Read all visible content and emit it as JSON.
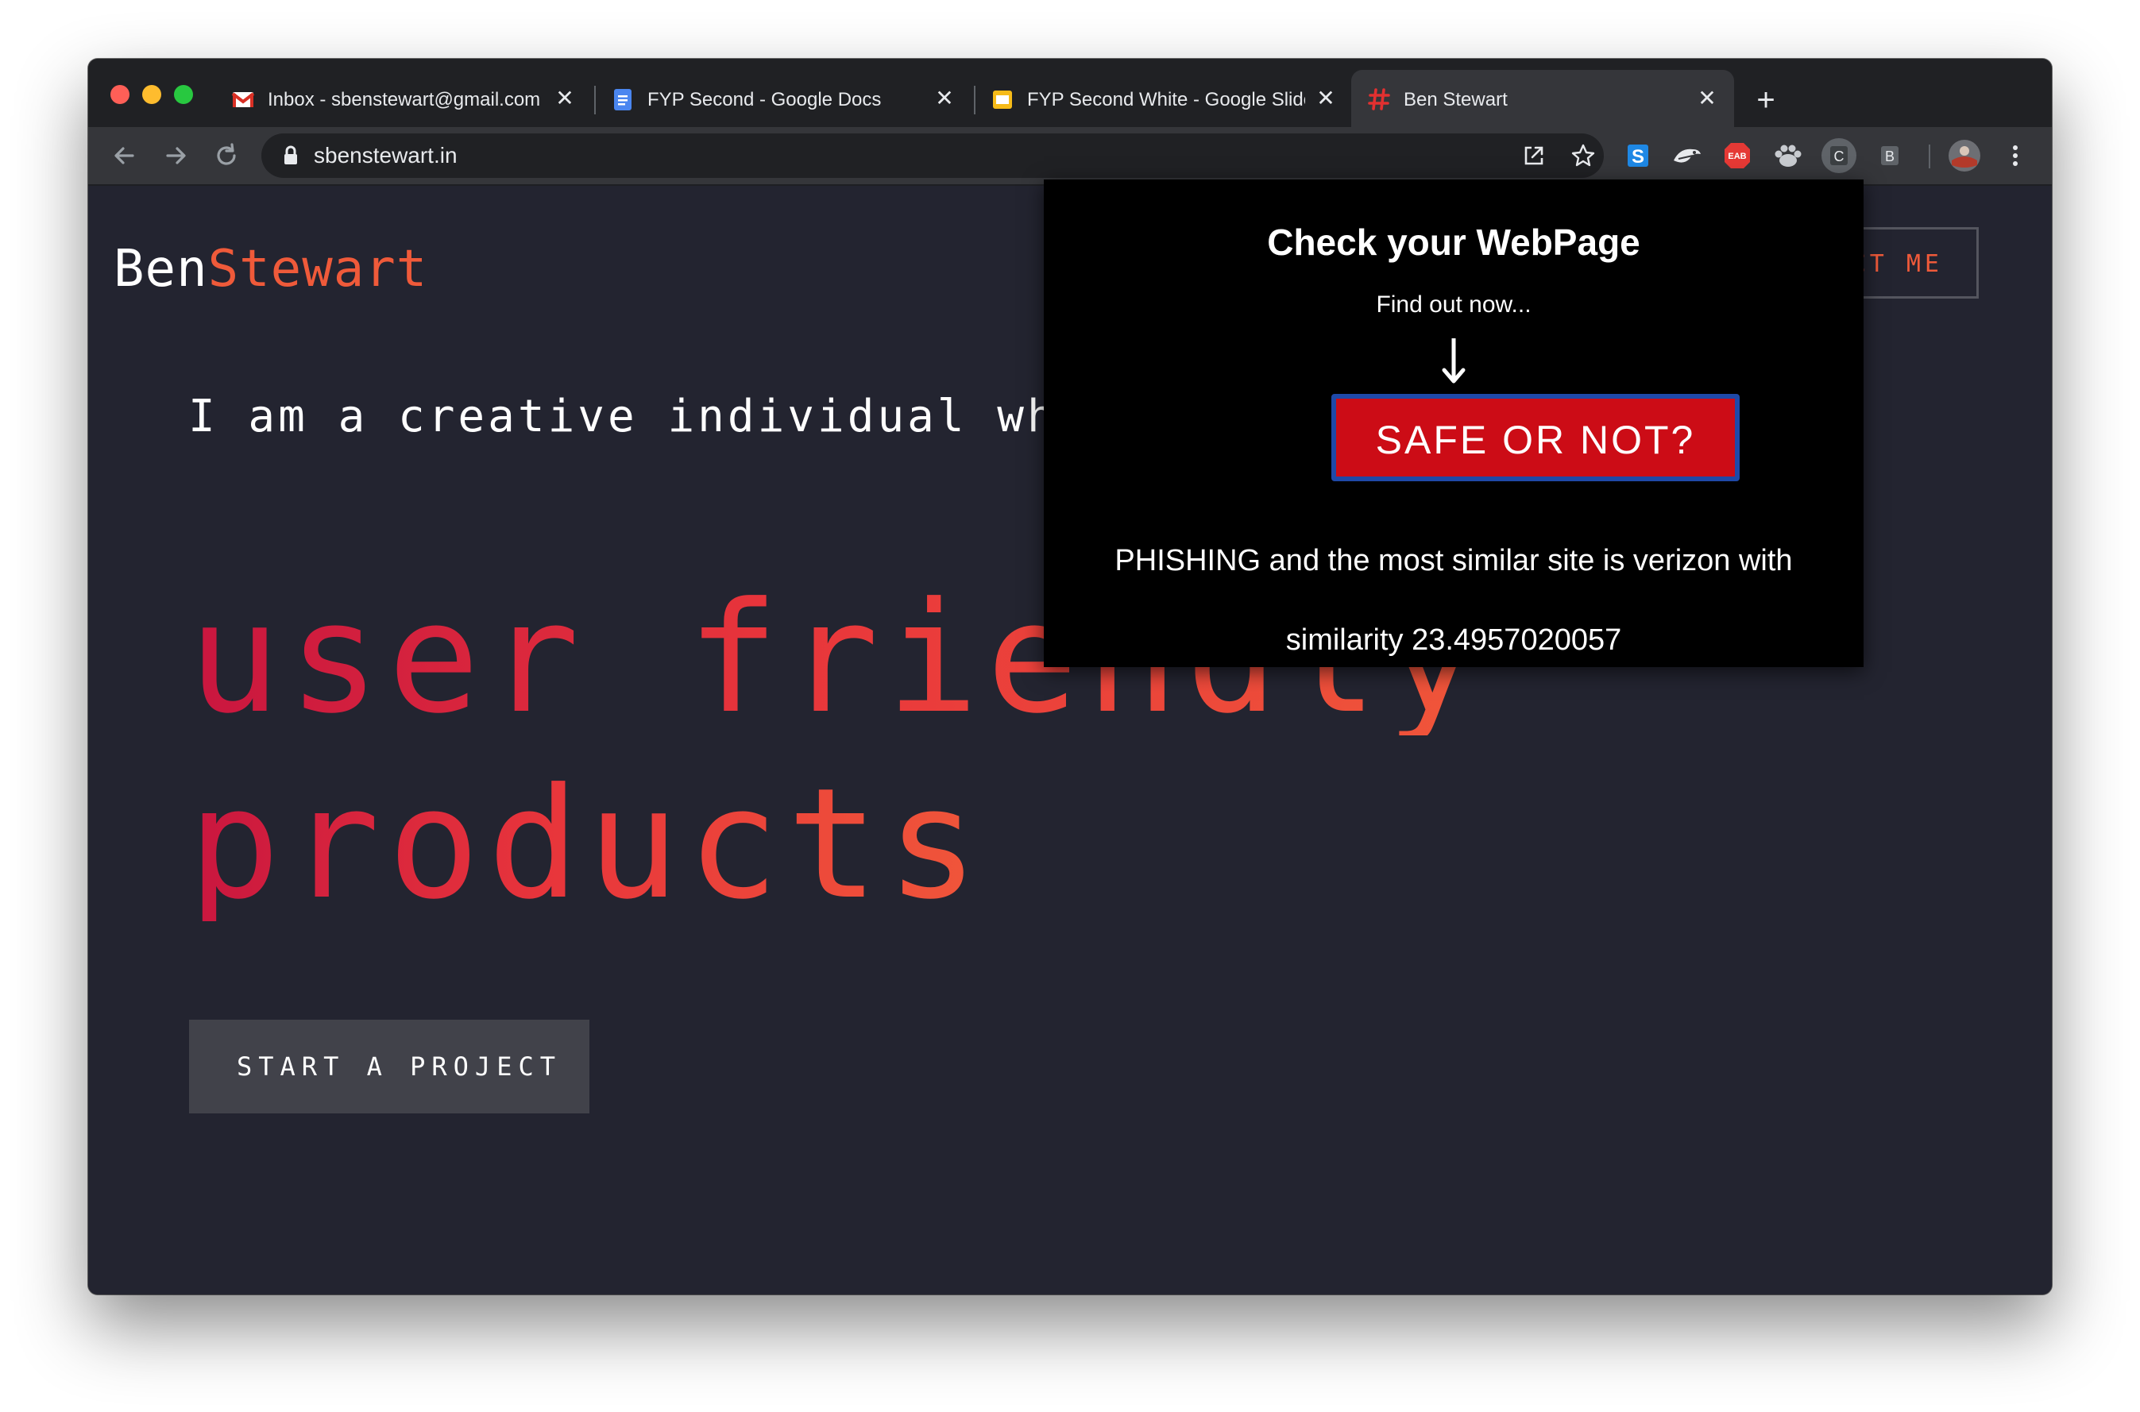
{
  "tabs": [
    {
      "title": "Inbox - sbenstewart@gmail.com",
      "icon": "gmail-icon"
    },
    {
      "title": "FYP Second - Google Docs",
      "icon": "google-docs-icon"
    },
    {
      "title": "FYP Second White - Google Slides",
      "icon": "google-slides-icon"
    },
    {
      "title": "Ben Stewart",
      "icon": "hash-icon",
      "active": true
    }
  ],
  "toolbar": {
    "url": "sbenstewart.in",
    "extensions": [
      "s-extension-icon",
      "bird-extension-icon",
      "eab-extension-icon",
      "paw-extension-icon",
      "c-extension-icon",
      "b-extension-icon",
      "profile-avatar"
    ],
    "c_label": "C",
    "b_label": "B",
    "eab_label": "EAB"
  },
  "site": {
    "logo_first": "Ben",
    "logo_second": "Stewart",
    "contact_label": "CONTACT ME",
    "contact_visible": "TACT ME",
    "intro": "I am a creative individual who de",
    "headline_line1": "user friendly",
    "headline_line2": "products",
    "start_label": "START A PROJECT"
  },
  "popup": {
    "title": "Check your WebPage",
    "subtitle": "Find out now...",
    "button_label": "SAFE OR NOT?",
    "result_line1": "PHISHING and the most similar site is verizon with",
    "result_line2": "similarity 23.4957020057"
  },
  "colors": {
    "accent": "#ef5a3a",
    "page_bg": "#232430",
    "safe_button": "#cc0c16",
    "safe_button_border": "#1f49a8"
  }
}
